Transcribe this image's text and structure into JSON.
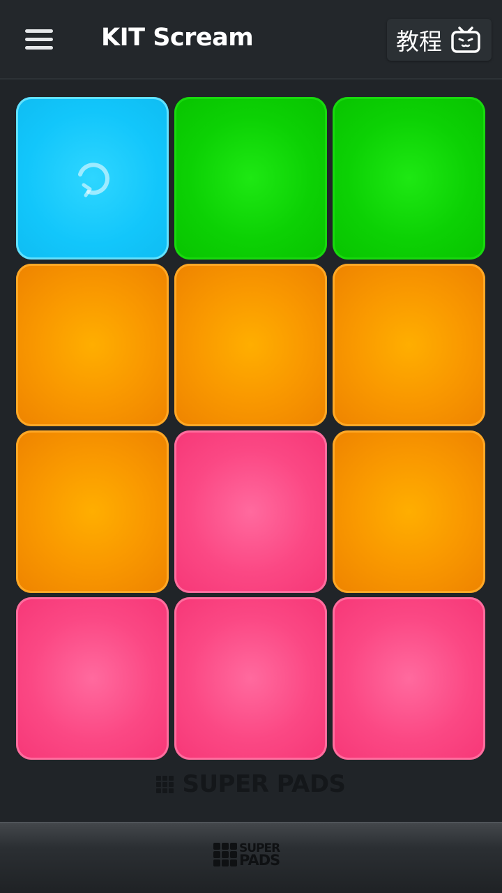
{
  "header": {
    "title": "KIT Scream",
    "tutorial_label": "教程",
    "menu_icon": "hamburger-menu-icon",
    "tutorial_icon": "tv-icon"
  },
  "pads": [
    {
      "color": "blue",
      "icon": "loop-icon"
    },
    {
      "color": "green"
    },
    {
      "color": "green"
    },
    {
      "color": "orange"
    },
    {
      "color": "orange"
    },
    {
      "color": "orange"
    },
    {
      "color": "orange"
    },
    {
      "color": "pink"
    },
    {
      "color": "orange"
    },
    {
      "color": "pink"
    },
    {
      "color": "pink"
    },
    {
      "color": "pink"
    }
  ],
  "colors": {
    "blue": "#12c6fb",
    "green": "#0cd104",
    "orange": "#f99800",
    "pink": "#fb4884",
    "background": "#202428"
  },
  "watermark": {
    "text": "SUPER PADS"
  },
  "footer": {
    "logo_line1": "SUPER",
    "logo_line2": "PADS"
  }
}
